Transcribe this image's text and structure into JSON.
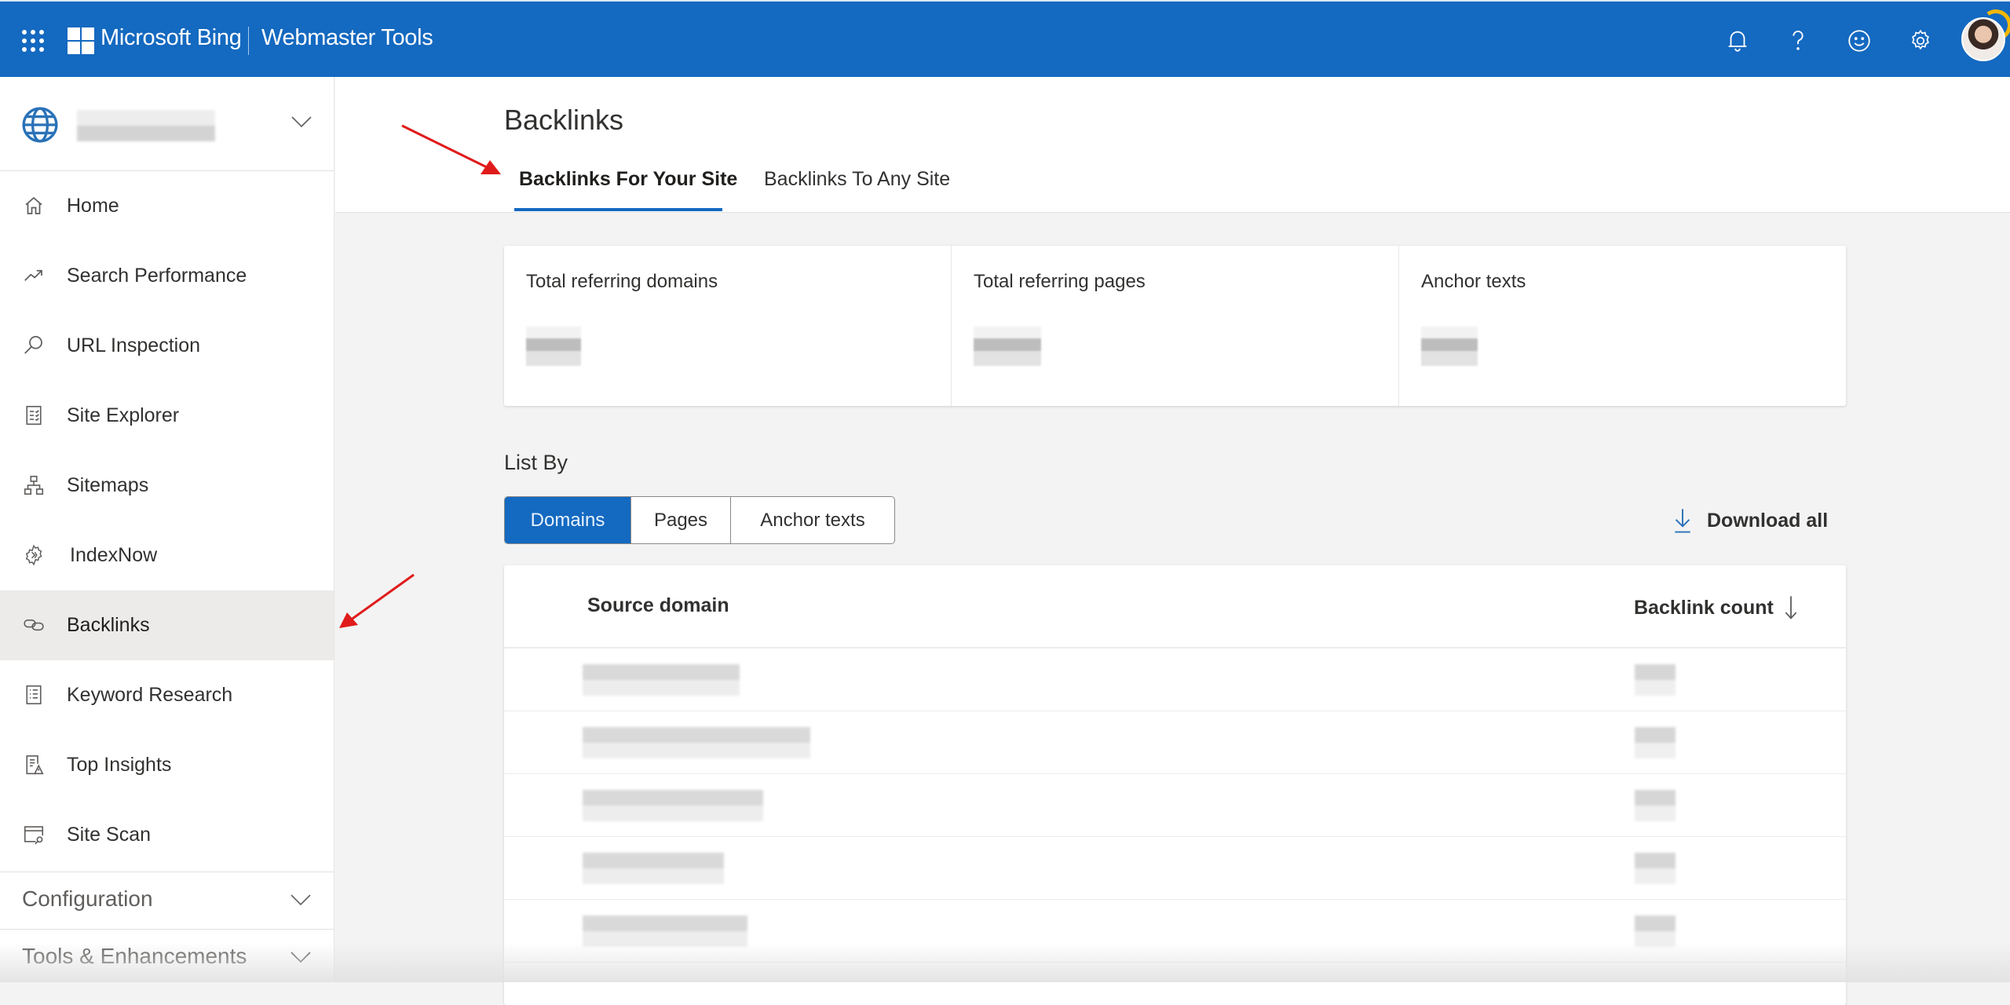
{
  "topbar": {
    "brand": "Microsoft Bing",
    "product": "Webmaster Tools",
    "icons": [
      "app-launcher-icon",
      "bell-icon",
      "help-icon",
      "feedback-smiley-icon",
      "gear-icon",
      "avatar"
    ],
    "accent": "#1469c0"
  },
  "sidebar": {
    "site_selector": {
      "icon": "globe-icon",
      "value": "[blurred site]"
    },
    "items": [
      {
        "label": "Home",
        "icon": "home-icon"
      },
      {
        "label": "Search Performance",
        "icon": "trending-up-icon"
      },
      {
        "label": "URL Inspection",
        "icon": "search-icon"
      },
      {
        "label": "Site Explorer",
        "icon": "checklist-icon"
      },
      {
        "label": "Sitemaps",
        "icon": "sitemap-icon"
      },
      {
        "label": "IndexNow",
        "icon": "indexnow-gear-icon"
      },
      {
        "label": "Backlinks",
        "icon": "link-icon",
        "active": true
      },
      {
        "label": "Keyword Research",
        "icon": "document-list-icon"
      },
      {
        "label": "Top Insights",
        "icon": "insights-warning-icon"
      },
      {
        "label": "Site Scan",
        "icon": "site-scan-icon"
      }
    ],
    "groups": [
      {
        "label": "Configuration",
        "expanded": false
      },
      {
        "label": "Tools & Enhancements",
        "expanded": false
      }
    ]
  },
  "main": {
    "title": "Backlinks",
    "tabs": [
      {
        "label": "Backlinks For Your Site",
        "active": true
      },
      {
        "label": "Backlinks To Any Site",
        "active": false
      }
    ],
    "summary_cards": [
      {
        "title": "Total referring domains",
        "value": "[blurred]"
      },
      {
        "title": "Total referring pages",
        "value": "[blurred]"
      },
      {
        "title": "Anchor texts",
        "value": "[blurred]"
      }
    ],
    "list_by": {
      "label": "List By",
      "options": [
        "Domains",
        "Pages",
        "Anchor texts"
      ],
      "selected": "Domains"
    },
    "download_all": "Download all",
    "table": {
      "columns": [
        "Source domain",
        "Backlink count"
      ],
      "sort": {
        "column": "Backlink count",
        "direction": "descending"
      },
      "rows": [
        {
          "source_domain": "[blurred]",
          "backlink_count": "[blurred]"
        },
        {
          "source_domain": "[blurred]",
          "backlink_count": "[blurred]"
        },
        {
          "source_domain": "[blurred]",
          "backlink_count": "[blurred]"
        },
        {
          "source_domain": "[blurred]",
          "backlink_count": "[blurred]"
        },
        {
          "source_domain": "[blurred]",
          "backlink_count": "[blurred]"
        }
      ]
    }
  },
  "annotations": {
    "arrow_color": "#e01b1b",
    "arrows": [
      "points-to-tab-backlinks-for-your-site",
      "points-to-sidebar-backlinks"
    ]
  }
}
